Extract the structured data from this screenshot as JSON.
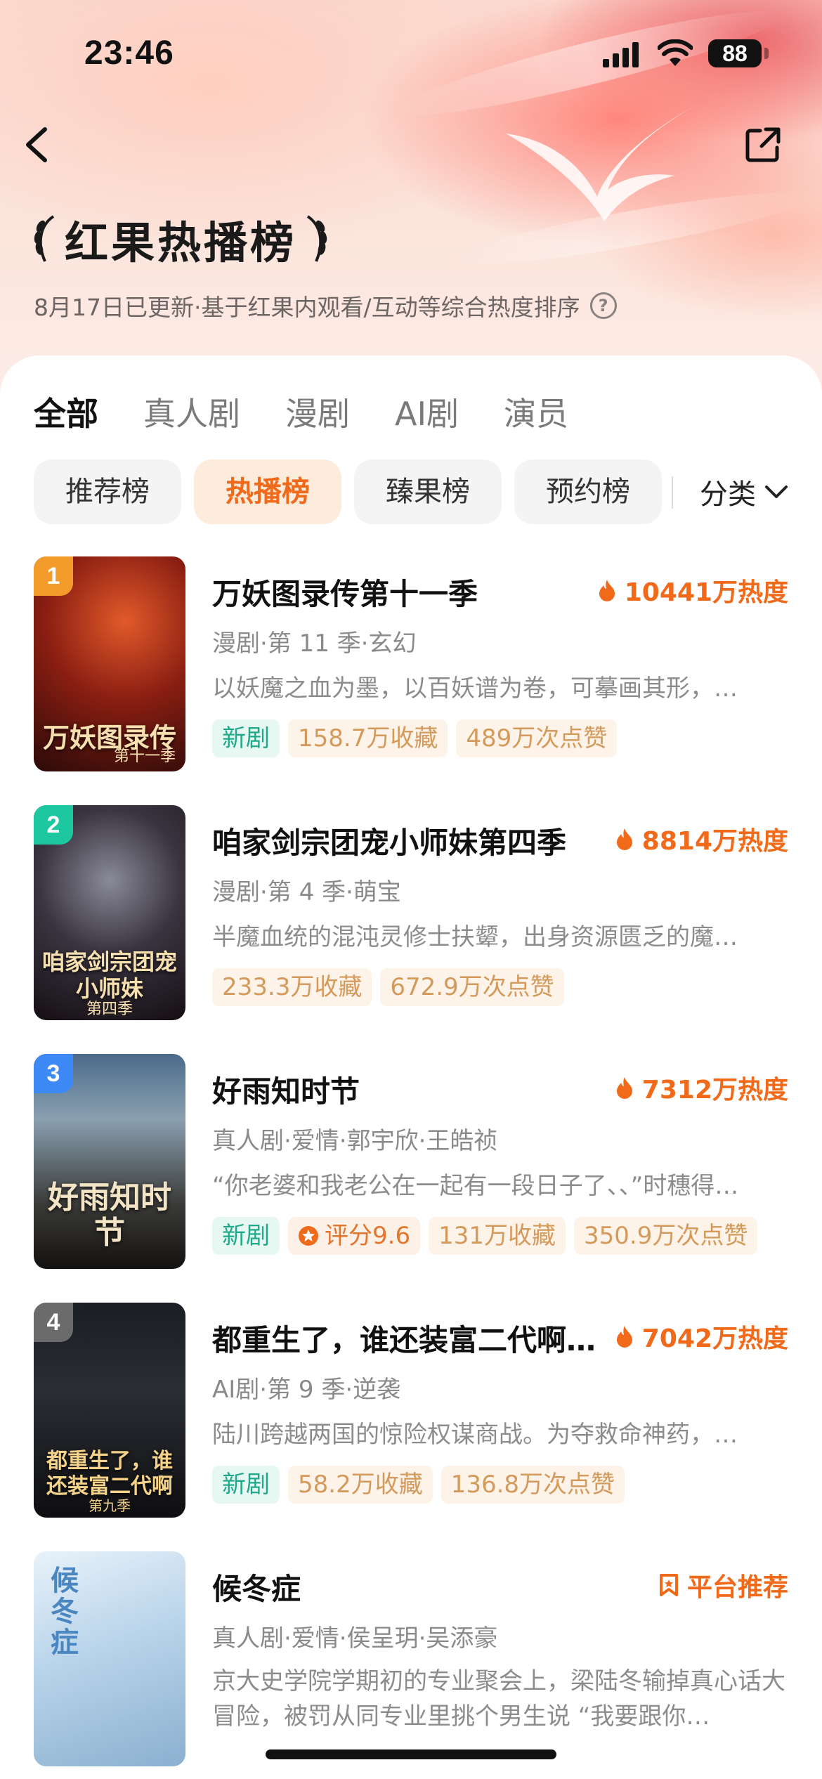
{
  "status_bar": {
    "time": "23:46",
    "battery": "88"
  },
  "header": {
    "title": "红果热播榜",
    "subtitle": "8月17日已更新·基于红果内观看/互动等综合热度排序"
  },
  "tabs": [
    {
      "label": "全部",
      "active": true
    },
    {
      "label": "真人剧",
      "active": false
    },
    {
      "label": "漫剧",
      "active": false
    },
    {
      "label": "AI剧",
      "active": false
    },
    {
      "label": "演员",
      "active": false
    }
  ],
  "chips": [
    {
      "label": "推荐榜",
      "active": false
    },
    {
      "label": "热播榜",
      "active": true
    },
    {
      "label": "臻果榜",
      "active": false
    },
    {
      "label": "预约榜",
      "active": false
    }
  ],
  "filter_label": "分类",
  "items": [
    {
      "rank": "1",
      "title": "万妖图录传第十一季",
      "heat": "10441万热度",
      "meta": "漫剧·第 11 季·玄幻",
      "desc": "以妖魔之血为墨，以百妖谱为卷，可摹画其形，…",
      "poster_text": "万妖图录传",
      "poster_sub": "第十一季",
      "tags": {
        "new": "新剧",
        "fav": "158.7万收藏",
        "like": "489万次点赞"
      }
    },
    {
      "rank": "2",
      "title": "咱家剑宗团宠小师妹第四季",
      "heat": "8814万热度",
      "meta": "漫剧·第 4 季·萌宝",
      "desc": "半魔血统的混沌灵修士扶颦，出身资源匮乏的魔…",
      "poster_text": "咱家剑宗团宠小师妹",
      "poster_sub": "第四季",
      "tags": {
        "fav": "233.3万收藏",
        "like": "672.9万次点赞"
      }
    },
    {
      "rank": "3",
      "title": "好雨知时节",
      "heat": "7312万热度",
      "meta": "真人剧·爱情·郭宇欣·王皓祯",
      "desc": "“你老婆和我老公在一起有一段日子了、、”时穗得…",
      "poster_text": "好雨知时节",
      "tags": {
        "new": "新剧",
        "score": "评分9.6",
        "fav": "131万收藏",
        "like": "350.9万次点赞"
      }
    },
    {
      "rank": "4",
      "title": "都重生了，谁还装富二代啊…",
      "heat": "7042万热度",
      "meta": "AI剧·第 9 季·逆袭",
      "desc": "陆川跨越两国的惊险权谋商战。为夺救命神药，…",
      "poster_text": "都重生了，谁还装富二代啊",
      "poster_sub": "第九季",
      "tags": {
        "new": "新剧",
        "fav": "58.2万收藏",
        "like": "136.8万次点赞"
      }
    },
    {
      "title": "候冬症",
      "platform": "平台推荐",
      "meta": "真人剧·爱情·侯呈玥·吴添豪",
      "desc": "京大史学院学期初的专业聚会上，梁陆冬输掉真心话大冒险，被罚从同专业里挑个男生说 “我要跟你…",
      "poster_text": "候冬症"
    }
  ],
  "colors": {
    "accent": "#f06a1a",
    "new_tag": "#1fa98a",
    "rank1": "#f39c2c",
    "rank2": "#1dc7a0",
    "rank3": "#3d8af7",
    "rank4": "#6b6b6b"
  }
}
